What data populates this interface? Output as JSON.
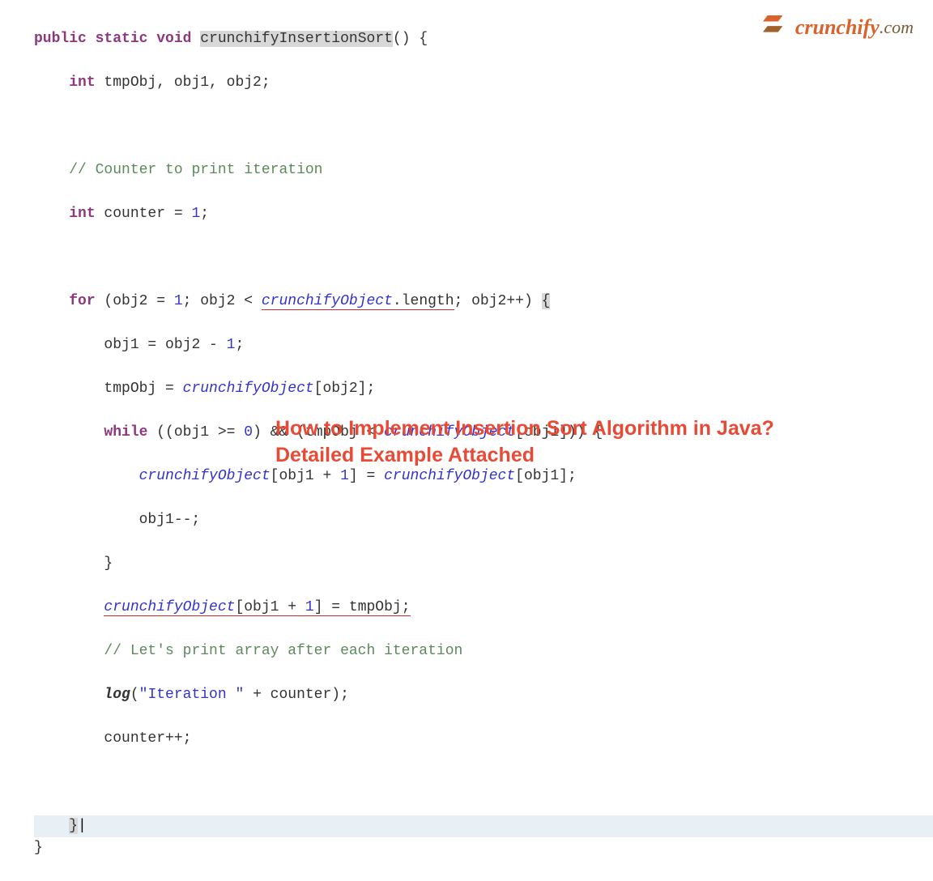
{
  "logo": {
    "brand": "crunchify",
    "suffix": ".com"
  },
  "title": {
    "line1": "How to Implement Insertion Sort Algorithm in Java?",
    "line2": "Detailed Example Attached"
  },
  "code": {
    "l1": {
      "kw1": "public",
      "kw2": "static",
      "kw3": "void",
      "fn": "crunchifyInsertionSort",
      "paren": "() {"
    },
    "l2": {
      "type": "int",
      "rest": " tmpObj, obj1, obj2;"
    },
    "l3": {
      "comment": "// Counter to print iteration"
    },
    "l4": {
      "type": "int",
      "var": " counter = ",
      "num": "1",
      "semi": ";"
    },
    "l5": {
      "kw": "for",
      "p1": " (obj2 = ",
      "n1": "1",
      "p2": "; obj2 < ",
      "field": "crunchifyObject",
      "dot": ".",
      "prop": "length",
      "p3": "; obj2++) ",
      "brace": "{"
    },
    "l6": {
      "p1": "obj1 = obj2 - ",
      "n1": "1",
      "semi": ";"
    },
    "l7": {
      "p1": "tmpObj = ",
      "field": "crunchifyObject",
      "p2": "[obj2];"
    },
    "l8": {
      "kw": "while",
      "p1": " ((obj1 >= ",
      "n1": "0",
      "p2": ") && (tmpObj < ",
      "field": "crunchifyObject",
      "p3": "[obj1])) {"
    },
    "l9": {
      "field1": "crunchifyObject",
      "p1": "[obj1 + ",
      "n1": "1",
      "p2": "] = ",
      "field2": "crunchifyObject",
      "p3": "[obj1];"
    },
    "l10": {
      "text": "obj1--;"
    },
    "l11": {
      "text": "}"
    },
    "l12": {
      "field": "crunchifyObject",
      "p1": "[obj1 + ",
      "n1": "1",
      "p2": "] = tmpObj;"
    },
    "l13": {
      "comment": "// Let's print array after each iteration"
    },
    "l14": {
      "func": "log",
      "p1": "(",
      "str": "\"Iteration \"",
      "p2": " + counter);"
    },
    "l15": {
      "text": "counter++;"
    },
    "l16": {
      "text": "}"
    },
    "l17": {
      "text": "}"
    }
  }
}
